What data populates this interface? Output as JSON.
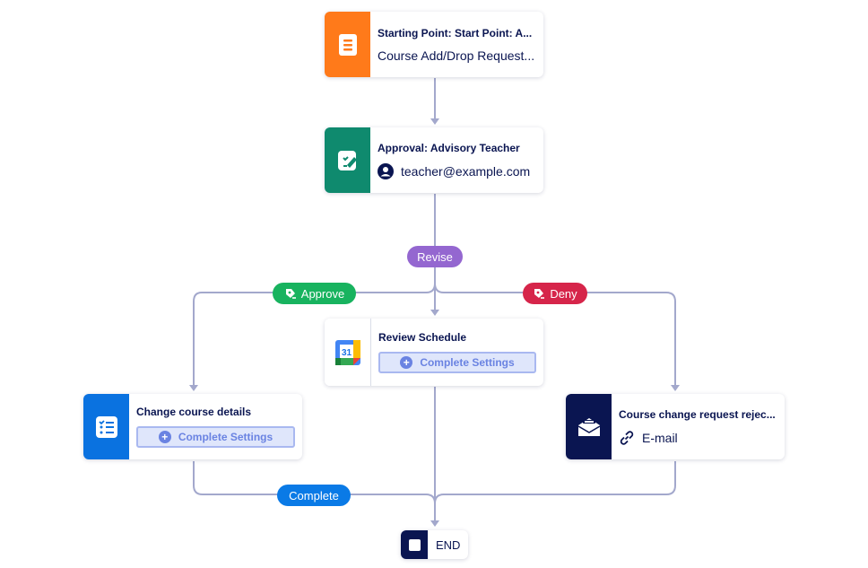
{
  "nodes": {
    "start": {
      "title": "Starting Point: Start Point: A...",
      "subtitle": "Course Add/Drop Request...",
      "icon": "form-icon",
      "color": "#ff7a1a"
    },
    "approval": {
      "title": "Approval: Advisory Teacher",
      "subtitle": "teacher@example.com",
      "icon": "approval-icon",
      "sub_icon": "user-icon",
      "color": "#0f8a6e"
    },
    "review": {
      "title": "Review Schedule",
      "button": "Complete Settings",
      "icon": "google-calendar-icon",
      "calendar_day": "31"
    },
    "change": {
      "title": "Change course details",
      "button": "Complete Settings",
      "icon": "checklist-icon",
      "color": "#0a72e0"
    },
    "reject": {
      "title": "Course change request rejec...",
      "subtitle": "E-mail",
      "icon": "email-icon",
      "sub_icon": "link-icon",
      "color": "#0a1551"
    },
    "end": {
      "label": "END",
      "color": "#0a1551"
    }
  },
  "branches": {
    "revise": {
      "label": "Revise",
      "color": "#9467d0"
    },
    "approve": {
      "label": "Approve",
      "color": "#18b35f"
    },
    "deny": {
      "label": "Deny",
      "color": "#d6254a"
    },
    "complete": {
      "label": "Complete",
      "color": "#0a7ae6"
    }
  },
  "edge_color": "#a3a8cc"
}
